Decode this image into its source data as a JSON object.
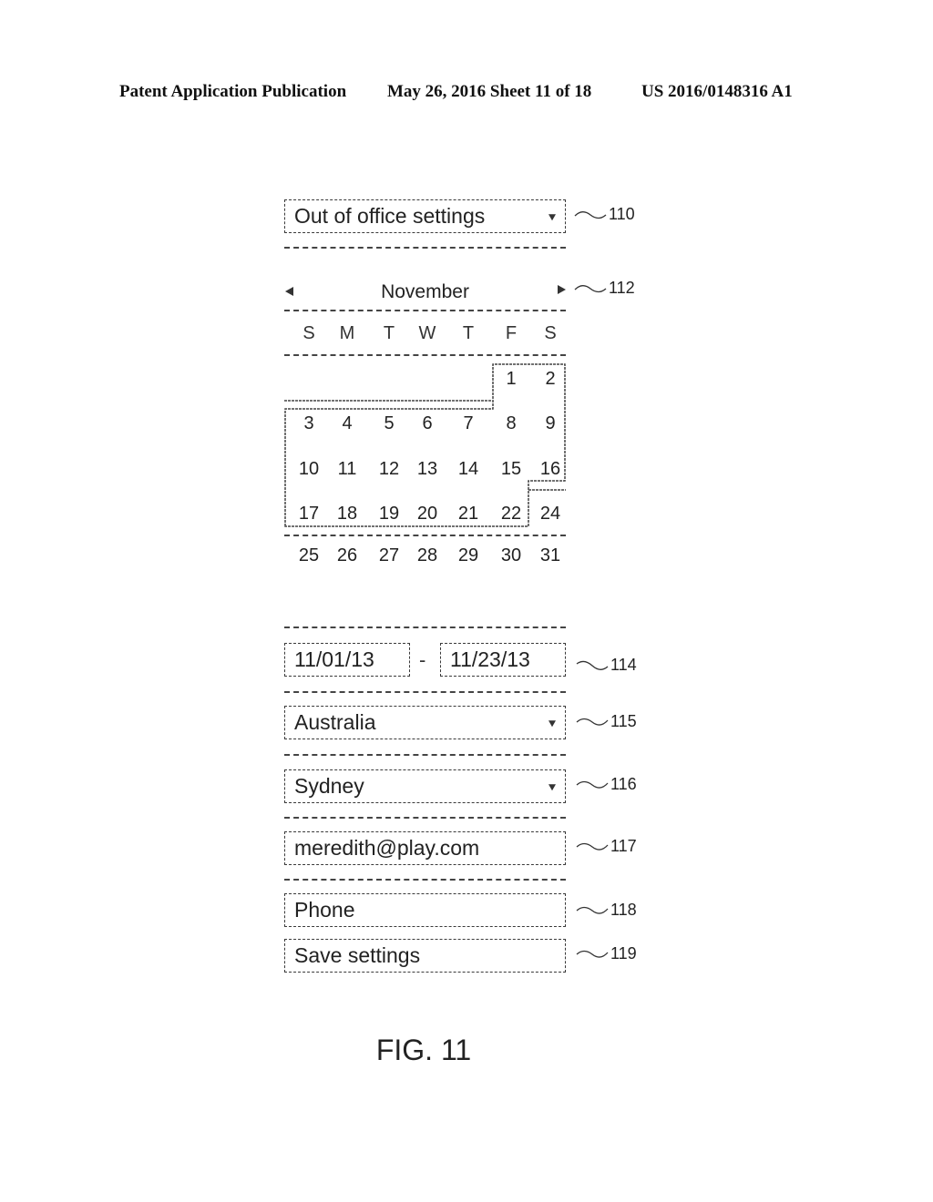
{
  "header": {
    "publication": "Patent Application Publication",
    "date_sheet": "May 26, 2016  Sheet 11 of 18",
    "patent_number": "US 2016/0148316 A1"
  },
  "settings_dropdown": {
    "value": "Out of office settings",
    "icon": "caret-down-icon",
    "ref": "110"
  },
  "calendar": {
    "month": "November",
    "prev_icon": "triangle-left-icon",
    "next_icon": "triangle-right-icon",
    "ref": "112",
    "weekdays": [
      "S",
      "M",
      "T",
      "W",
      "T",
      "F",
      "S"
    ],
    "weeks": [
      [
        "",
        "",
        "",
        "",
        "",
        "1",
        "2"
      ],
      [
        "3",
        "4",
        "5",
        "6",
        "7",
        "8",
        "9"
      ],
      [
        "10",
        "11",
        "12",
        "13",
        "14",
        "15",
        "16"
      ],
      [
        "17",
        "18",
        "19",
        "20",
        "21",
        "22",
        "24"
      ],
      [
        "25",
        "26",
        "27",
        "28",
        "29",
        "30",
        "31"
      ]
    ],
    "selected_range": {
      "start": "1",
      "end": "22"
    }
  },
  "date_range": {
    "start": "11/01/13",
    "separator": "-",
    "end": "11/23/13",
    "ref": "114"
  },
  "country_dropdown": {
    "value": "Australia",
    "icon": "caret-down-icon",
    "ref": "115"
  },
  "city_dropdown": {
    "value": "Sydney",
    "icon": "caret-down-icon",
    "ref": "116"
  },
  "email_field": {
    "value": "meredith@play.com",
    "ref": "117"
  },
  "phone_field": {
    "placeholder": "Phone",
    "ref": "118"
  },
  "save_button": {
    "label": "Save settings",
    "ref": "119"
  },
  "figure_label": "FIG. 11"
}
